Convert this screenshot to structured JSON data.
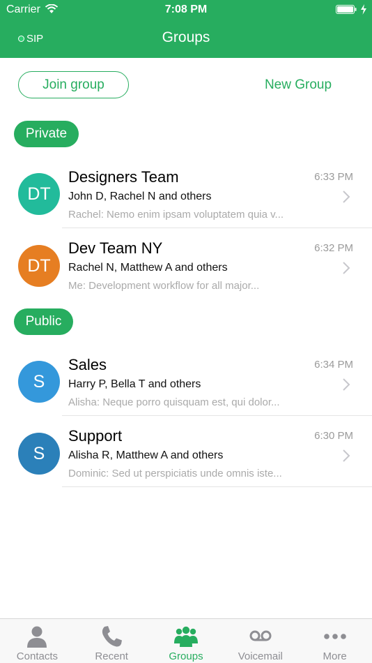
{
  "status_bar": {
    "carrier": "Carrier",
    "time": "7:08 PM"
  },
  "nav": {
    "sip_label": "SIP",
    "title": "Groups"
  },
  "actions": {
    "join_group": "Join group",
    "new_group": "New Group"
  },
  "sections": {
    "private": {
      "label": "Private",
      "groups": [
        {
          "initials": "DT",
          "name": "Designers Team",
          "members": "John D, Rachel N and others",
          "preview": "Rachel: Nemo enim ipsam voluptatem quia v...",
          "time": "6:33 PM",
          "avatar_color": "#22bb9b"
        },
        {
          "initials": "DT",
          "name": "Dev Team NY",
          "members": "Rachel N, Matthew A and others",
          "preview": "Me: Development workflow for all major...",
          "time": "6:32 PM",
          "avatar_color": "#e67e22"
        }
      ]
    },
    "public": {
      "label": "Public",
      "groups": [
        {
          "initials": "S",
          "name": "Sales",
          "members": "Harry P, Bella T and others",
          "preview": "Alisha: Neque porro quisquam est, qui dolor...",
          "time": "6:34 PM",
          "avatar_color": "#3498db"
        },
        {
          "initials": "S",
          "name": "Support",
          "members": "Alisha R, Matthew A and others",
          "preview": "Dominic: Sed ut perspiciatis unde omnis iste...",
          "time": "6:30 PM",
          "avatar_color": "#2b80b9"
        }
      ]
    }
  },
  "tabs": [
    {
      "label": "Contacts",
      "icon": "person-icon"
    },
    {
      "label": "Recent",
      "icon": "phone-icon"
    },
    {
      "label": "Groups",
      "icon": "group-icon",
      "active": true
    },
    {
      "label": "Voicemail",
      "icon": "voicemail-icon"
    },
    {
      "label": "More",
      "icon": "more-icon"
    }
  ],
  "colors": {
    "accent": "#27ad5f",
    "inactive_tab": "#8e8e93"
  }
}
